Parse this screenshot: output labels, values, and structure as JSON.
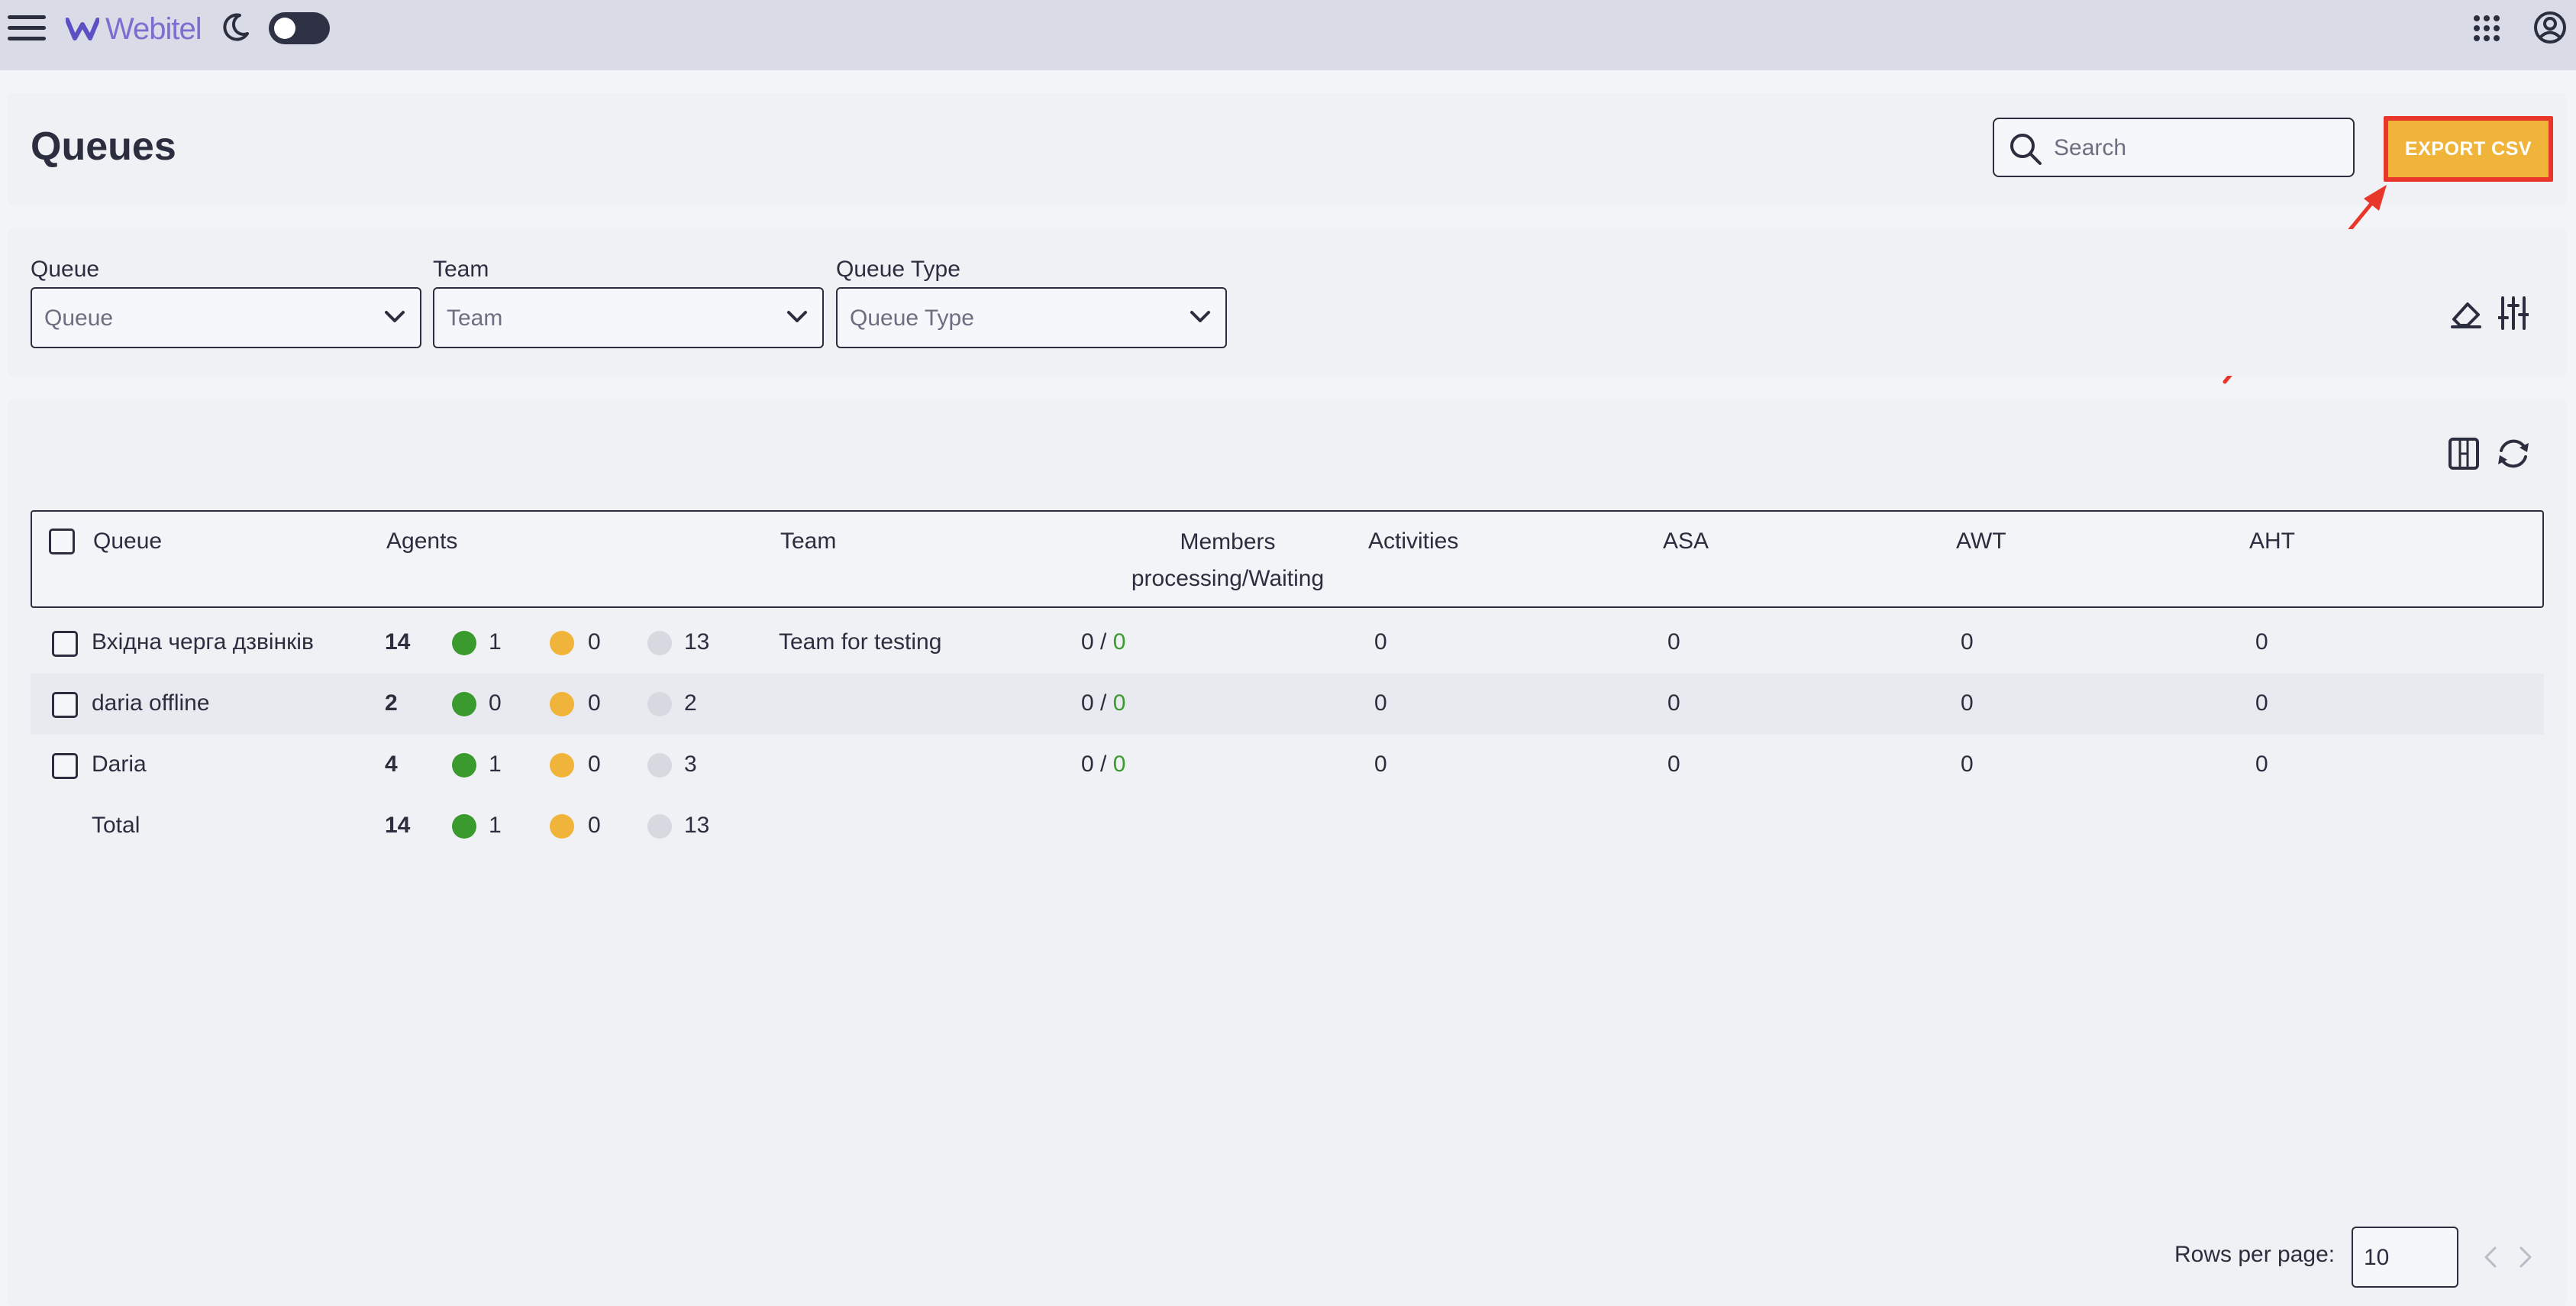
{
  "app": {
    "logo_text": "Webitel"
  },
  "header": {
    "title": "Queues",
    "search_placeholder": "Search",
    "export_label": "EXPORT CSV"
  },
  "filters": [
    {
      "label": "Queue",
      "placeholder": "Queue"
    },
    {
      "label": "Team",
      "placeholder": "Team"
    },
    {
      "label": "Queue Type",
      "placeholder": "Queue Type"
    }
  ],
  "table": {
    "columns": {
      "queue": "Queue",
      "agents": "Agents",
      "team": "Team",
      "members": "Members processing/Waiting",
      "activities": "Activities",
      "asa": "ASA",
      "awt": "AWT",
      "aht": "AHT"
    },
    "rows": [
      {
        "queue": "Вхідна черга дзвінків",
        "agents_total": "14",
        "online": "1",
        "pause": "0",
        "offline": "13",
        "team": "Team for testing",
        "processing": "0 /",
        "waiting": "0",
        "activities": "0",
        "asa": "0",
        "awt": "0",
        "aht": "0"
      },
      {
        "queue": "daria offline",
        "agents_total": "2",
        "online": "0",
        "pause": "0",
        "offline": "2",
        "team": "",
        "processing": "0 /",
        "waiting": "0",
        "activities": "0",
        "asa": "0",
        "awt": "0",
        "aht": "0"
      },
      {
        "queue": "Daria",
        "agents_total": "4",
        "online": "1",
        "pause": "0",
        "offline": "3",
        "team": "",
        "processing": "0 /",
        "waiting": "0",
        "activities": "0",
        "asa": "0",
        "awt": "0",
        "aht": "0"
      }
    ],
    "total": {
      "label": "Total",
      "agents_total": "14",
      "online": "1",
      "pause": "0",
      "offline": "13"
    }
  },
  "pagination": {
    "rows_per_page_label": "Rows per page:",
    "rows_per_page_value": "10"
  },
  "colors": {
    "accent": "#f0b43a",
    "highlight_border": "#e8372a",
    "online": "#3a9a2e",
    "pause": "#f0b43a",
    "offline": "#d8d9e0"
  }
}
